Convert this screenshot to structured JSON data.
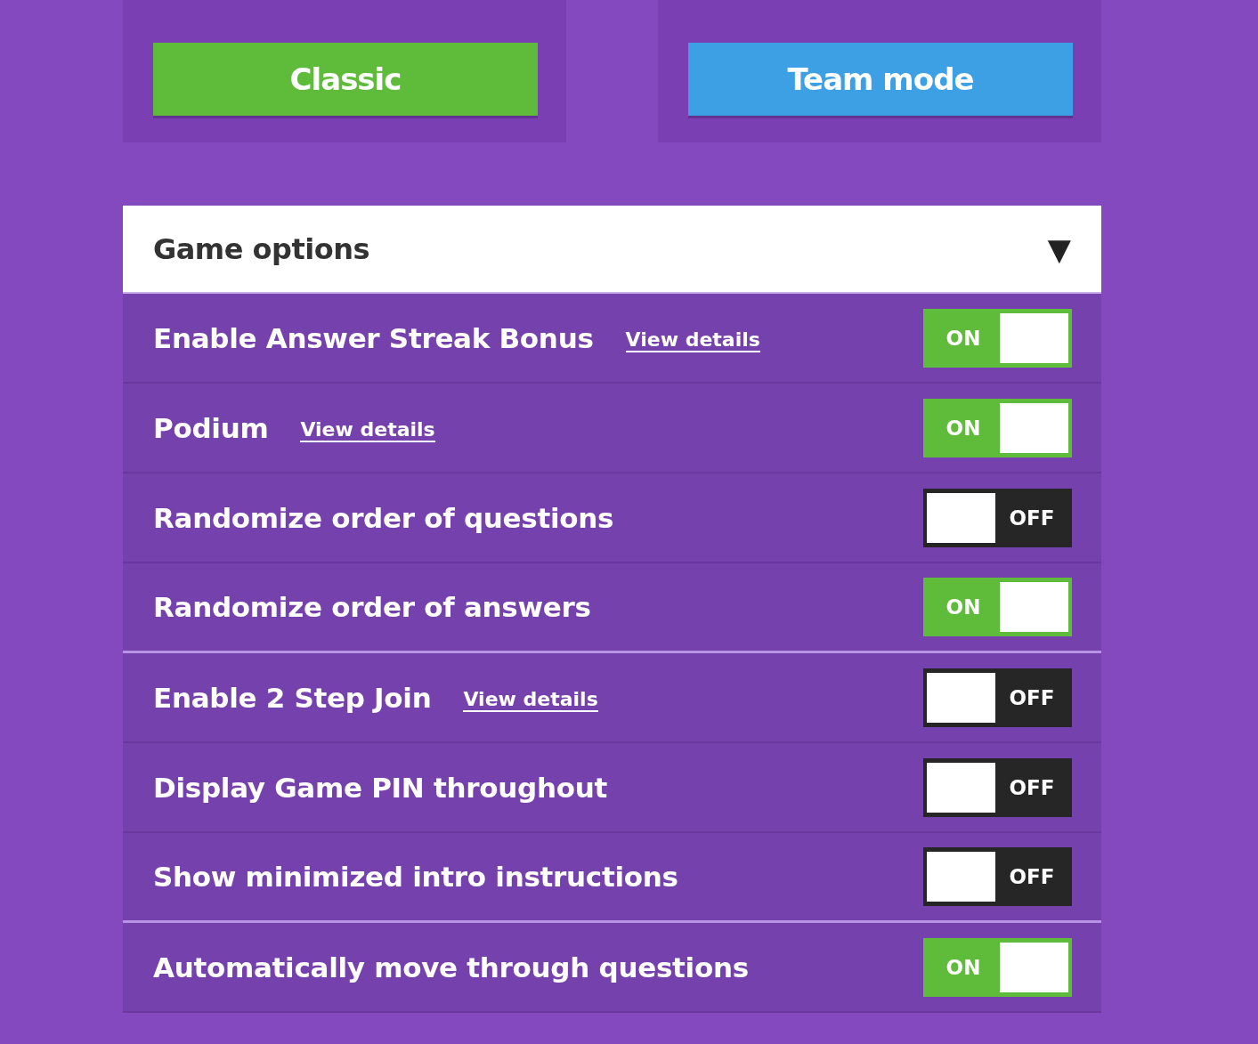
{
  "modes": [
    {
      "label": "Classic",
      "color": "#5fbb3a"
    },
    {
      "label": "Team mode",
      "color": "#3d9fe4"
    }
  ],
  "options_header": {
    "title": "Game options",
    "caret": "▼"
  },
  "groups": [
    {
      "rows": [
        {
          "label": "Enable Answer Streak Bonus",
          "link": "View details",
          "on": true,
          "state_text": "ON"
        },
        {
          "label": "Podium",
          "link": "View details",
          "on": true,
          "state_text": "ON"
        },
        {
          "label": "Randomize order of questions",
          "on": false,
          "state_text": "OFF"
        },
        {
          "label": "Randomize order of answers",
          "on": true,
          "state_text": "ON"
        }
      ]
    },
    {
      "rows": [
        {
          "label": "Enable 2 Step Join",
          "link": "View details",
          "on": false,
          "state_text": "OFF"
        },
        {
          "label": "Display Game PIN throughout",
          "on": false,
          "state_text": "OFF"
        },
        {
          "label": "Show minimized intro instructions",
          "on": false,
          "state_text": "OFF"
        }
      ]
    },
    {
      "rows": [
        {
          "label": "Automatically move through questions",
          "on": true,
          "state_text": "ON"
        }
      ]
    }
  ]
}
